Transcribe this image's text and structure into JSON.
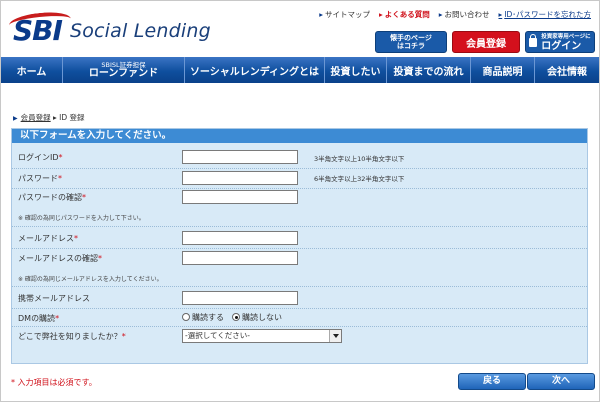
{
  "header": {
    "brand": "SBI",
    "product": "Social Lending",
    "utility_links": [
      {
        "label": "サイトマップ"
      },
      {
        "label": "よくある質問"
      },
      {
        "label": "お問い合わせ"
      },
      {
        "label": "ID･パスワードを忘れた方"
      }
    ],
    "beginner_button": {
      "line1": "懐手のページ",
      "line2": "はコチラ"
    },
    "register_button": "会員登録",
    "login_button": {
      "small": "投資家専用ページに",
      "big": "ログイン"
    }
  },
  "nav": {
    "items": [
      {
        "label": "ホーム"
      },
      {
        "sub": "SBISL証券担保",
        "label": "ローンファンド"
      },
      {
        "label": "ソーシャルレンディングとは"
      },
      {
        "label": "投資したい"
      },
      {
        "label": "投資までの流れ"
      },
      {
        "label": "商品説明"
      },
      {
        "label": "会社情報"
      }
    ]
  },
  "breadcrumb": {
    "link": "会員登録",
    "separator": "▸",
    "current": "ID 登録"
  },
  "form": {
    "title": "以下フォームを入力してください。",
    "fields": {
      "login_id": {
        "label": "ログインID",
        "required": "*",
        "value": "",
        "hint": "3半角文字以上10半角文字以下"
      },
      "password": {
        "label": "パスワード",
        "required": "*",
        "value": "",
        "hint": "6半角文字以上32半角文字以下"
      },
      "password_confirm": {
        "label": "パスワードの確認",
        "required": "*",
        "value": "",
        "note": "※ 確認の為同じパスワードを入力して下さい。"
      },
      "email": {
        "label": "メールアドレス",
        "required": "*",
        "value": ""
      },
      "email_confirm": {
        "label": "メールアドレスの確認",
        "required": "*",
        "value": "",
        "note": "※ 確認の為同じメールアドレスを入力してください。"
      },
      "mobile_email": {
        "label": "携帯メールアドレス",
        "value": ""
      },
      "dm": {
        "label": "DMの購読",
        "required": "*",
        "options": [
          "購読する",
          "購読しない"
        ],
        "selected": "購読しない"
      },
      "source": {
        "label": "どこで弊社を知りましたか？",
        "required": "*",
        "selected": "-選択してください-"
      }
    }
  },
  "footer": {
    "required_note": "* 入力項目は必須です。",
    "back_button": "戻る",
    "next_button": "次へ"
  },
  "colors": {
    "brand_blue": "#0f4f9e",
    "accent_red": "#d4101c",
    "form_bg": "#d8eaf7",
    "form_title": "#3d8bd4"
  }
}
